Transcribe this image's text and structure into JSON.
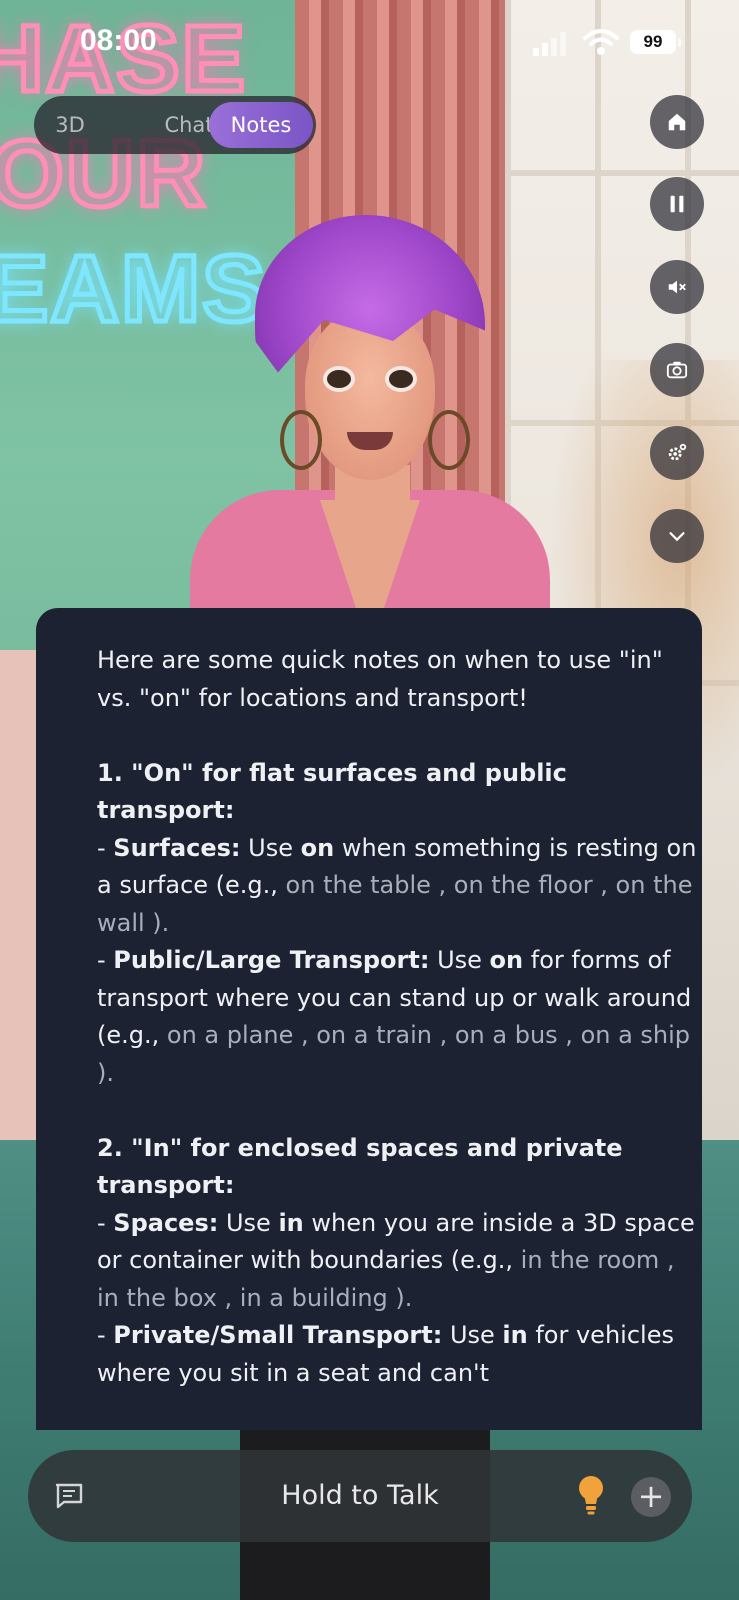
{
  "status_bar": {
    "time": "08:00",
    "battery": "99"
  },
  "tabs": {
    "t3d": "3D",
    "chat": "Chat",
    "notes": "Notes"
  },
  "right_buttons": [
    "home-icon",
    "pause-icon",
    "mute-icon",
    "camera-icon",
    "settings-icon",
    "chevron-down-icon"
  ],
  "notes": {
    "intro": "Here are some quick notes on when to use \"in\" vs. \"on\" for locations and transport!",
    "s1_heading": "1. \"On\" for flat surfaces and public transport:",
    "s1_surfaces_label": "Surfaces:",
    "s1_surfaces_t1": " Use ",
    "s1_surfaces_on": "on",
    "s1_surfaces_t2": " when something is resting on a surface (e.g., ",
    "s1_ex1": "on the table",
    "s1_ex2": "on the floor",
    "s1_ex3": "on the wall",
    "s1_public_label": "Public/Large Transport:",
    "s1_public_t1": " Use ",
    "s1_public_on": "on",
    "s1_public_t2": " for forms of transport where you can stand up or walk around (e.g., ",
    "s1_ex4": "on a plane",
    "s1_ex5": "on a train",
    "s1_ex6": "on a bus",
    "s1_ex7": "on a ship",
    "s2_heading": "2. \"In\" for enclosed spaces and private transport:",
    "s2_spaces_label": "Spaces:",
    "s2_spaces_t1": " Use ",
    "s2_spaces_in": "in",
    "s2_spaces_t2": " when you are inside a 3D space or container with boundaries (e.g., ",
    "s2_ex1": "in the room",
    "s2_ex2": "in the box",
    "s2_ex3": "in a building",
    "s2_private_label": "Private/Small Transport:",
    "s2_private_t1": " Use ",
    "s2_private_in": "in",
    "s2_private_t2": " for vehicles where you sit in a seat and can't"
  },
  "bottom_bar": {
    "hold_label": "Hold to Talk",
    "plus": "+"
  },
  "colors": {
    "card_bg": "#1d2233",
    "tab_active": "#8a62d0",
    "example_text": "#a9aebb",
    "bulb": "#f2a23a"
  }
}
